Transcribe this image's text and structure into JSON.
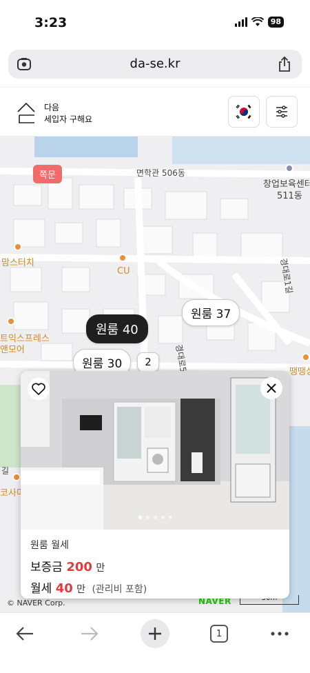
{
  "status": {
    "time": "3:23",
    "battery": "98"
  },
  "browser": {
    "url": "da-se.kr"
  },
  "header": {
    "brand_line1": "다음",
    "brand_line2": "세입자 구해요"
  },
  "map": {
    "labels": {
      "building": "면학관 506동",
      "center1": "창업보육센터",
      "center2": "511동",
      "momstouch": "맘스터치",
      "cu": "CU",
      "express1": "트익스프레스",
      "express2": "앤모어",
      "road1": "경대로5길",
      "road2": "경대로1길",
      "ttang": "땡땡싱",
      "left1": "길",
      "left2": "코사미",
      "tag": "쪽문"
    },
    "pins": {
      "pin_37": "원룸 37",
      "pin_40": "원룸 40",
      "pin_30": "원룸 30",
      "pin_count": "2"
    },
    "copyright": "© NAVER Corp.",
    "naver": "NAVER",
    "scale": "50m"
  },
  "card": {
    "type": "원룸 월세",
    "deposit_label": "보증금",
    "deposit_value": "200",
    "deposit_unit": "만",
    "rent_label": "월세",
    "rent_value": "40",
    "rent_unit": "만",
    "rent_note": "(관리비 포함)",
    "photo_count": 5,
    "photo_index": 1
  },
  "toolbar": {
    "tabs": "1"
  },
  "colors": {
    "accent_red": "#e23b3b",
    "naver_green": "#1ec800",
    "tag_red": "#f26b6b"
  }
}
